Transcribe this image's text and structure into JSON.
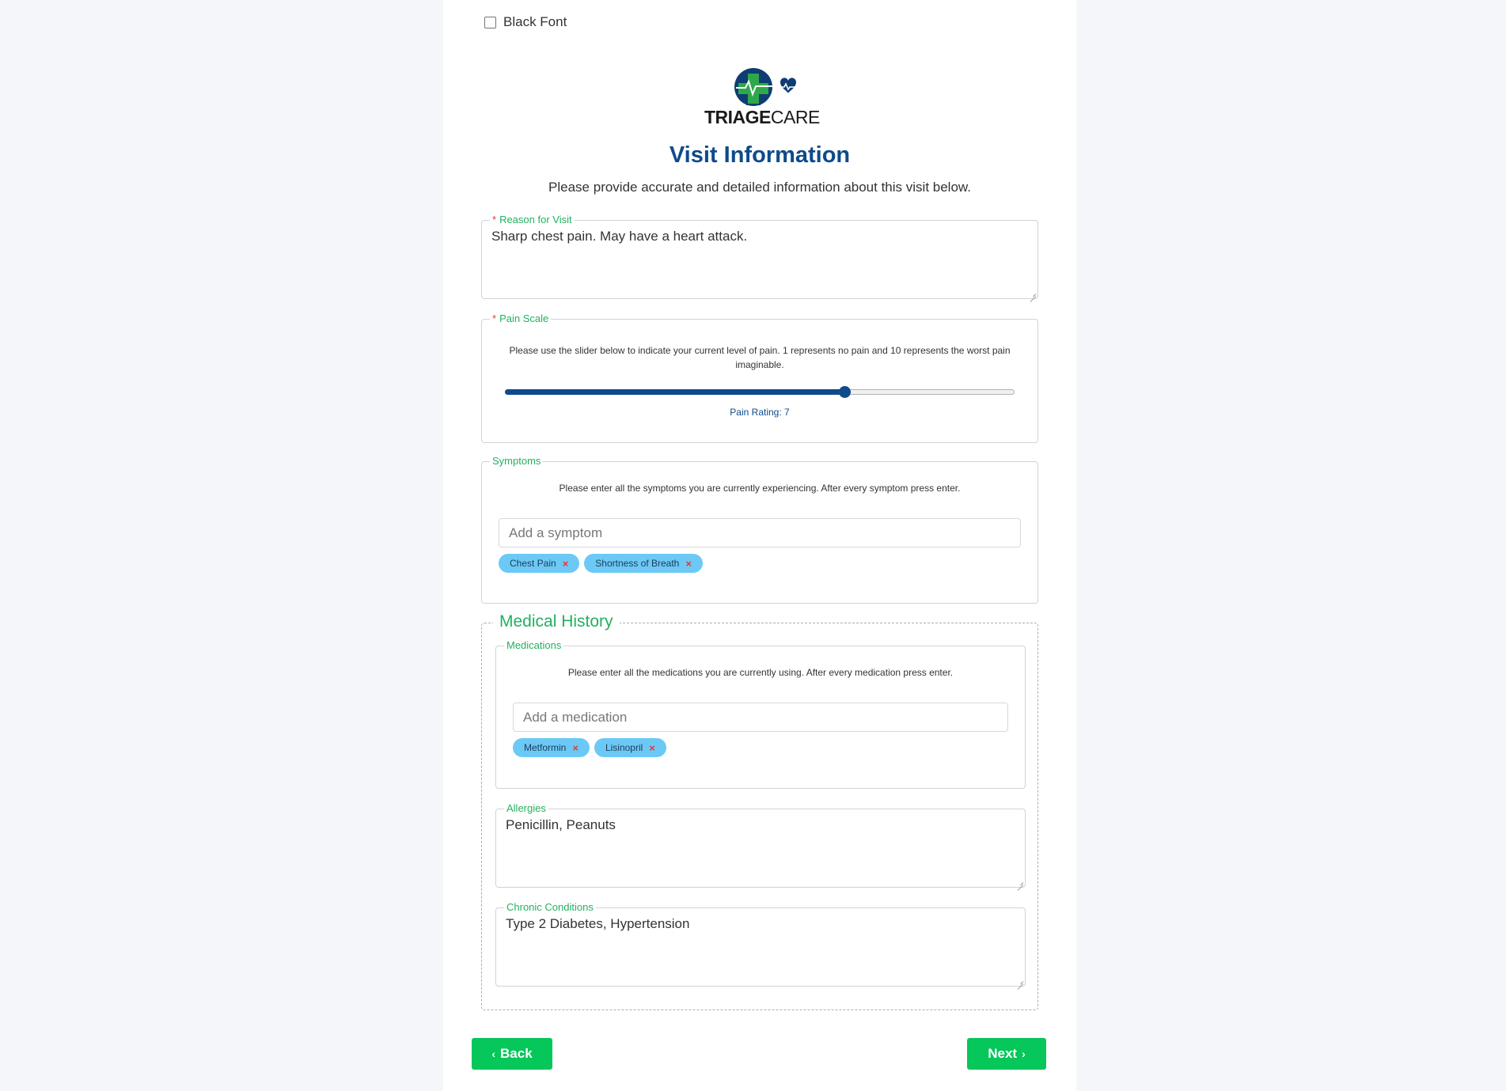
{
  "settings": {
    "black_font_label": "Black Font",
    "black_font_checked": false
  },
  "logo": {
    "bold": "TRIAGE",
    "light": "CARE"
  },
  "page": {
    "title": "Visit Information",
    "subtitle": "Please provide accurate and detailed information about this visit below."
  },
  "reason": {
    "label": "Reason for Visit",
    "required_mark": "*",
    "value": "Sharp chest pain. May have a heart attack."
  },
  "pain": {
    "label": "Pain Scale",
    "required_mark": "*",
    "description": "Please use the slider below to indicate your current level of pain. 1 represents no pain and 10 represents the worst pain imaginable.",
    "min": 1,
    "max": 10,
    "value": 7,
    "rating_text": "Pain Rating: 7"
  },
  "symptoms": {
    "label": "Symptoms",
    "description": "Please enter all the symptoms you are currently experiencing. After every symptom press enter.",
    "placeholder": "Add a symptom",
    "tags": [
      "Chest Pain",
      "Shortness of Breath"
    ],
    "remove_glyph": "×"
  },
  "medical_history": {
    "label": "Medical History",
    "medications": {
      "label": "Medications",
      "description": "Please enter all the medications you are currently using. After every medication press enter.",
      "placeholder": "Add a medication",
      "tags": [
        "Metformin",
        "Lisinopril"
      ]
    },
    "allergies": {
      "label": "Allergies",
      "value": "Penicillin, Peanuts"
    },
    "chronic": {
      "label": "Chronic Conditions",
      "value": "Type 2 Diabetes, Hypertension"
    }
  },
  "nav": {
    "back_label": "Back",
    "next_label": "Next",
    "back_icon": "chevron-left-icon",
    "next_icon": "chevron-right-icon"
  },
  "colors": {
    "brand_blue": "#0e4a8c",
    "accent_green": "#22b15e",
    "button_green": "#05c75a",
    "tag_blue": "#6cc9f5",
    "required_red": "#e53935"
  }
}
